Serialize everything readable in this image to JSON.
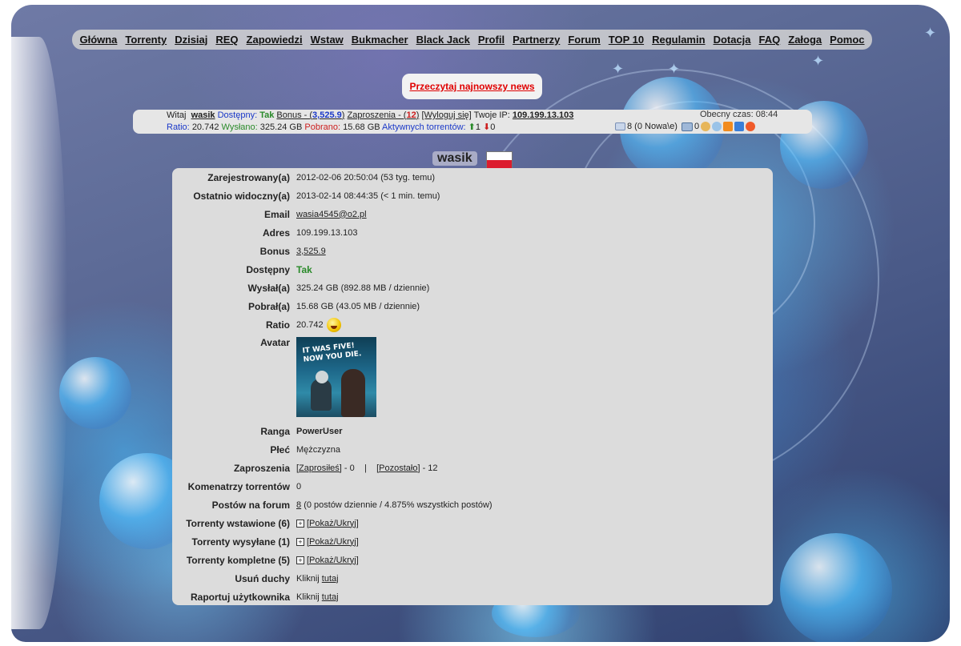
{
  "nav": {
    "items": [
      "Główna",
      "Torrenty",
      "Dzisiaj",
      "REQ",
      "Zapowiedzi",
      "Wstaw",
      "Bukmacher",
      "Black Jack",
      "Profil",
      "Partnerzy",
      "Forum",
      "TOP 10",
      "Regulamin",
      "Dotacja",
      "FAQ",
      "Załoga",
      "Pomoc"
    ]
  },
  "news": {
    "label": "Przeczytaj najnowszy news"
  },
  "status": {
    "welcome": "Witaj",
    "username": "wasik",
    "available_label": "Dostępny:",
    "available_value": "Tak",
    "bonus_label": "Bonus - (",
    "bonus_value": "3,525.9",
    "bonus_close": ")",
    "invites_label": "Zaproszenia - (",
    "invites_value": "12",
    "invites_close": ")",
    "logout": "[Wyloguj się]",
    "ip_label": "Twoje IP:",
    "ip_value": "109.199.13.103",
    "time_label": "Obecny czas:",
    "time_value": "08:44",
    "ratio_label": "Ratio:",
    "ratio_value": "20.742",
    "uploaded_label": "Wysłano:",
    "uploaded_value": "325.24 GB",
    "downloaded_label": "Pobrano:",
    "downloaded_value": "15.68 GB",
    "active_label": "Aktywnych torrentów:",
    "active_up": "1",
    "active_down": "0",
    "messages": "8 (0 Nowa\\e)",
    "pm_count": "0"
  },
  "profile": {
    "username": "wasik",
    "rows": {
      "registered": {
        "label": "Zarejestrowany(a)",
        "value": "2012-02-06 20:50:04 (53 tyg. temu)"
      },
      "last_seen": {
        "label": "Ostatnio widoczny(a)",
        "value": "2013-02-14 08:44:35 (< 1 min. temu)"
      },
      "email": {
        "label": "Email",
        "value": "wasia4545@o2.pl"
      },
      "address": {
        "label": "Adres",
        "value": "109.199.13.103"
      },
      "bonus": {
        "label": "Bonus",
        "value": "3,525.9"
      },
      "available": {
        "label": "Dostępny",
        "value": "Tak"
      },
      "uploaded": {
        "label": "Wysłał(a)",
        "value": "325.24 GB (892.88 MB / dziennie)"
      },
      "downloaded": {
        "label": "Pobrał(a)",
        "value": "15.68 GB (43.05 MB / dziennie)"
      },
      "ratio": {
        "label": "Ratio",
        "value": "20.742"
      },
      "avatar": {
        "label": "Avatar",
        "caption": "IT WAS FIVE! NOW YOU DIE."
      },
      "rank": {
        "label": "Ranga",
        "value": "PowerUser"
      },
      "gender": {
        "label": "Płeć",
        "value": "Mężczyzna"
      },
      "invites": {
        "label": "Zaproszenia",
        "invited_link": "[Zaprosiłeś]",
        "invited_count": "- 0",
        "sep": "|",
        "left_link": "[Pozostało]",
        "left_count": "- 12"
      },
      "comments": {
        "label": "Komenatrzy torrentów",
        "value": "0"
      },
      "forum_posts": {
        "label": "Postów na forum",
        "count": "8",
        "detail": "(0 postów dziennie / 4.875% wszystkich postów)"
      },
      "uploaded_torrents": {
        "label": "Torrenty wstawione (6)",
        "toggle": "[Pokaż/Ukryj]"
      },
      "seeding": {
        "label": "Torrenty wysyłane (1)",
        "toggle": "[Pokaż/Ukryj]"
      },
      "completed": {
        "label": "Torrenty kompletne (5)",
        "toggle": "[Pokaż/Ukryj]"
      },
      "remove_ghosts": {
        "label": "Usuń duchy",
        "prefix": "Kliknij",
        "link": "tutaj"
      },
      "report_user": {
        "label": "Raportuj użytkownika",
        "prefix": "Kliknij",
        "link": "tutaj"
      }
    }
  },
  "colors": {
    "accent_red": "#e00000",
    "green": "#2a8a2a",
    "blue": "#1a38c8",
    "panel": "#dcdcdc"
  }
}
